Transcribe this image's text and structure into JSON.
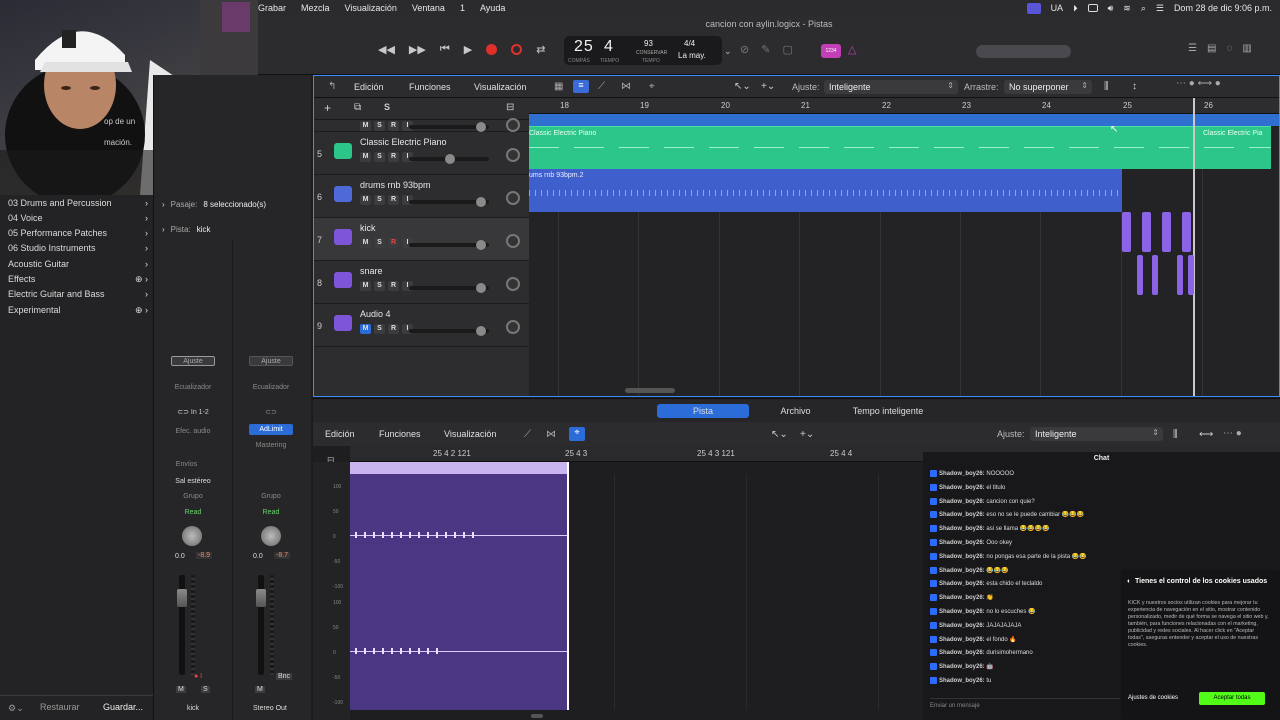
{
  "menubar": {
    "items": [
      "Grabar",
      "Mezcla",
      "Visualización",
      "Ventana",
      "1",
      "Ayuda"
    ],
    "lang": "UA",
    "datetime": "Dom 28 de dic 9:06 p.m."
  },
  "window": {
    "title": "cancion con aylin.logicx - Pistas"
  },
  "lcd": {
    "bars": "25",
    "beat": "4",
    "tempo": "93",
    "tempo_label": "CONSERVAR",
    "sig": "4/4",
    "key": "La may.",
    "bars_label": "COMPÁS",
    "beat_label": "TIEMPO",
    "tempo_sub": "TEMPO",
    "counter": "1234"
  },
  "library": {
    "items": [
      "03 Drums and Percussion",
      "04 Voice",
      "05 Performance Patches",
      "06 Studio Instruments",
      "Acoustic Guitar",
      "Effects",
      "Electric Guitar and Bass",
      "Experimental"
    ],
    "footer_restore": "Restaurar",
    "footer_save": "Guardar...",
    "partial_text1": "op de un",
    "partial_text2": "mación."
  },
  "inspector": {
    "region_label": "Pasaje:",
    "region_value": "8 seleccionado(s)",
    "track_label": "Pista:",
    "track_value": "kick",
    "strip1": {
      "setting": "Ajuste",
      "eq": "Ecualizador",
      "input": "In 1-2",
      "fx": "Efec. audio",
      "sends": "Envíos",
      "output": "Sal estéreo",
      "group": "Grupo",
      "auto": "Read",
      "vol": "0.0",
      "peak": "-8.9",
      "name": "kick",
      "m": "M",
      "s": "S"
    },
    "strip2": {
      "setting": "Ajuste",
      "eq": "Ecualizador",
      "plugin": "AdLimit",
      "mastering": "Mastering",
      "group": "Grupo",
      "auto": "Read",
      "vol": "0.0",
      "peak": "-8.7",
      "name": "Stereo Out",
      "m": "M",
      "bnc": "Bnc"
    }
  },
  "tracks_toolbar": {
    "edit": "Edición",
    "functions": "Funciones",
    "view": "Visualización",
    "snap_label": "Ajuste:",
    "snap_value": "Inteligente",
    "drag_label": "Arrastre:",
    "drag_value": "No superponer"
  },
  "ruler": [
    "18",
    "19",
    "20",
    "21",
    "22",
    "23",
    "24",
    "25",
    "26"
  ],
  "tracks": [
    {
      "num": "5",
      "name": "Classic Electric Piano",
      "color": "#2cc58a"
    },
    {
      "num": "6",
      "name": "drums rnb 93bpm",
      "color": "#4e6ad9"
    },
    {
      "num": "7",
      "name": "kick",
      "color": "#7e54d9"
    },
    {
      "num": "8",
      "name": "snare",
      "color": "#7e54d9"
    },
    {
      "num": "9",
      "name": "Audio 4",
      "color": "#7e54d9"
    }
  ],
  "regions": {
    "piano": "Classic Electric Piano",
    "piano2": "Classic Electric Pia",
    "drums": "ums rnb 93bpm.2"
  },
  "editor_tabs": [
    "Pista",
    "Archivo",
    "Tempo inteligente"
  ],
  "editor_toolbar": {
    "edit": "Edición",
    "functions": "Funciones",
    "view": "Visualización",
    "snap_label": "Ajuste:",
    "snap_value": "Inteligente"
  },
  "editor_ruler": [
    "25 4 2 121",
    "25 4 3",
    "25 4 3 121",
    "25 4 4"
  ],
  "editor_yaxis": [
    "100",
    "50",
    "0",
    "-50",
    "-100",
    "100",
    "50",
    "0",
    "-50",
    "-100"
  ],
  "chat": {
    "title": "Chat",
    "messages": [
      {
        "user": "Shadow_boy26:",
        "text": "NOOOOO"
      },
      {
        "user": "Shadow_boy26:",
        "text": "el titulo"
      },
      {
        "user": "Shadow_boy26:",
        "text": "cancion con quie?"
      },
      {
        "user": "Shadow_boy26:",
        "text": "eso no se le puede cambiar 😂😂😂"
      },
      {
        "user": "Shadow_boy26:",
        "text": "asi se llama 😂😂😂😂"
      },
      {
        "user": "Shadow_boy26:",
        "text": "Ooo okey"
      },
      {
        "user": "Shadow_boy26:",
        "text": "no pongas esa parte de la pista 😂😂"
      },
      {
        "user": "Shadow_boy26:",
        "text": "😂😂😂"
      },
      {
        "user": "Shadow_boy26:",
        "text": "esta chido el teclaldo"
      },
      {
        "user": "Shadow_boy26:",
        "text": "👏"
      },
      {
        "user": "Shadow_boy26:",
        "text": "no lo escuches 😂"
      },
      {
        "user": "Shadow_boy26:",
        "text": "JAJAJAJAJA"
      },
      {
        "user": "Shadow_boy26:",
        "text": "el fondo 🔥"
      },
      {
        "user": "Shadow_boy26:",
        "text": "durisimohermano"
      },
      {
        "user": "Shadow_boy26:",
        "text": "🤖"
      },
      {
        "user": "Shadow_boy26:",
        "text": "tu"
      }
    ],
    "input_placeholder": "Enviar un mensaje"
  },
  "cookie": {
    "title": "Tienes el control de los cookies usados",
    "body": "KICK y nuestros socios utilizan cookies para mejorar tu experiencia de navegación en el sitio, mostrar contenido personalizado, medir de qué forma se navega el sitio web y, también, para funciones relacionadas con el marketing, publicidad y redes sociales. Al hacer click en \"Aceptar todas\", aseguras entender y aceptar el uso de nuestras cookies.",
    "settings": "Ajustes de cookies",
    "accept": "Aceptar todas"
  }
}
